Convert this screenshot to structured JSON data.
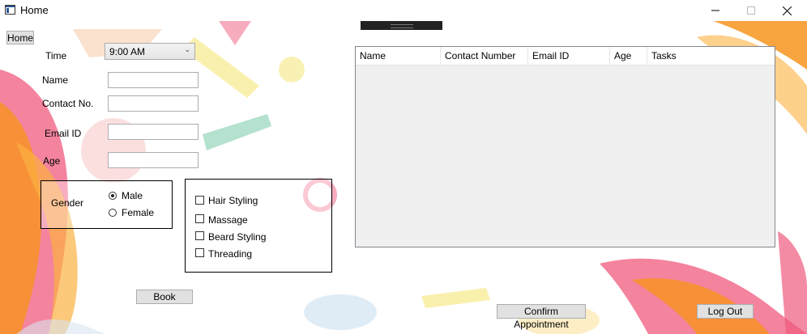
{
  "window": {
    "title": "Home"
  },
  "toolbar": {
    "home_label": "Home"
  },
  "form": {
    "time_label": "Time",
    "time_value": "9:00 AM",
    "name_label": "Name",
    "contact_label": "Contact No.",
    "email_label": "Email ID",
    "age_label": "Age",
    "gender_label": "Gender",
    "gender_options": [
      "Male",
      "Female"
    ],
    "gender_selected": "Male"
  },
  "services": {
    "options": [
      "Hair Styling",
      "Massage",
      "Beard Styling",
      "Threading"
    ]
  },
  "grid": {
    "columns": [
      "Name",
      "Contact Number",
      "Email ID",
      "Age",
      "Tasks"
    ],
    "rows": []
  },
  "actions": {
    "book_label": "Book",
    "confirm_label": "Confirm Appointment",
    "logout_label": "Log Out"
  },
  "colors": {
    "accent": "#f7941d",
    "pink": "#e84b6e",
    "grid_border": "#828790"
  }
}
